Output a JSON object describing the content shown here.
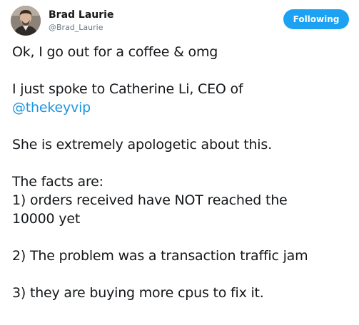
{
  "tweet": {
    "author": {
      "display_name": "Brad Laurie",
      "handle": "@Brad_Laurie",
      "avatar_icon": "user-photo-avatar"
    },
    "follow_button": {
      "label": "Following",
      "color": "#1da1f2"
    },
    "body": {
      "p1": "Ok, I go out for a coffee & omg",
      "p2_text": "I just spoke to Catherine Li, CEO of",
      "p2_mention": "@thekeyvip",
      "p3": "She is extremely apologetic about this.",
      "p4_line1": "The facts are:",
      "p4_line2": "1) orders received have NOT reached the",
      "p4_line3": "10000 yet",
      "p5": "2) The problem was a transaction  traffic jam",
      "p6": "3) they are buying more cpus to fix it."
    },
    "colors": {
      "link": "#1b95e0",
      "text": "#14171a",
      "secondary": "#657786"
    }
  }
}
